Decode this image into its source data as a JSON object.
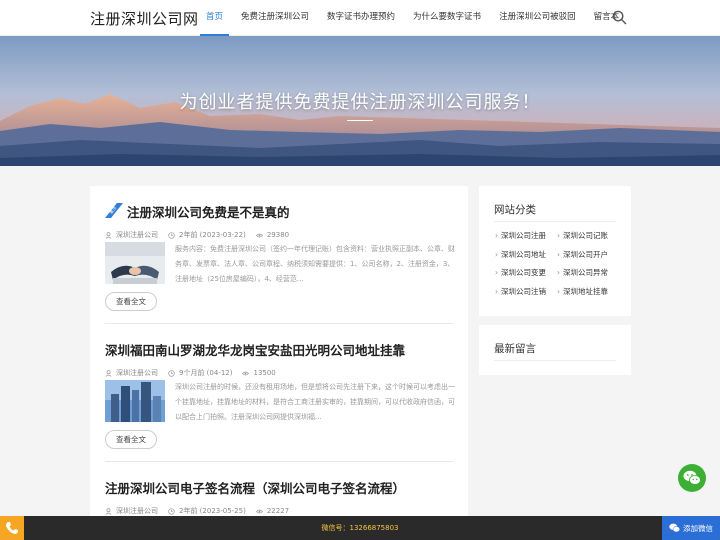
{
  "header": {
    "logo": "注册深圳公司网",
    "nav": [
      "首页",
      "免费注册深圳公司",
      "数字证书办理预约",
      "为什么要数字证书",
      "注册深圳公司被驳回",
      "留言本"
    ],
    "active_index": 0
  },
  "banner": {
    "title": "为创业者提供免费提供注册深圳公司服务！"
  },
  "articles": [
    {
      "sticky": true,
      "sticky_label": "置顶",
      "title": "注册深圳公司免费是不是真的",
      "author": "深圳注册公司",
      "date": "2年前 (2023-03-22)",
      "views": "29380",
      "excerpt": "服务内容：免费注册深圳公司（签约一年代理记账）包含资料：营业执照正副本、公章、财务章、发票章、法人章、公司章程、纳税须知需要提供：1、公司名称，2、注册资金，3、注册地址（25位房屋编码），4、经营范...",
      "readmore": "查看全文"
    },
    {
      "title": "深圳福田南山罗湖龙华龙岗宝安盐田光明公司地址挂靠",
      "author": "深圳注册公司",
      "date": "9个月前 (04-12)",
      "views": "13500",
      "excerpt": "深圳公司注册的时候，还没有租用场地，但是想将公司先注册下来，这个时候可以考虑出一个挂靠地址，挂靠地址的材料，是符合工商注册实审的，挂靠期间，可以代收政府信函，可以配合上门拍照。注册深圳公司网提供深圳福...",
      "readmore": "查看全文"
    },
    {
      "title": "注册深圳公司电子签名流程（深圳公司电子签名流程）",
      "author": "深圳注册公司",
      "date": "2年前 (2023-05-25)",
      "views": "22227"
    }
  ],
  "sidebar": {
    "categories_title": "网站分类",
    "categories": [
      "深圳公司注册",
      "深圳公司记账",
      "深圳公司地址",
      "深圳公司开户",
      "深圳公司变更",
      "深圳公司异常",
      "深圳公司注销",
      "深圳地址挂靠"
    ],
    "comments_title": "最新留言"
  },
  "footer": {
    "wechat_id": "微信号：13266875803",
    "add_wechat": "添加微信"
  },
  "colors": {
    "accent": "#2f7fd8",
    "wechat_green": "#3cb034",
    "footer_bg": "#2a2a2a",
    "phone_orange": "#f5a623",
    "add_wechat_blue": "#2b6fd6"
  }
}
